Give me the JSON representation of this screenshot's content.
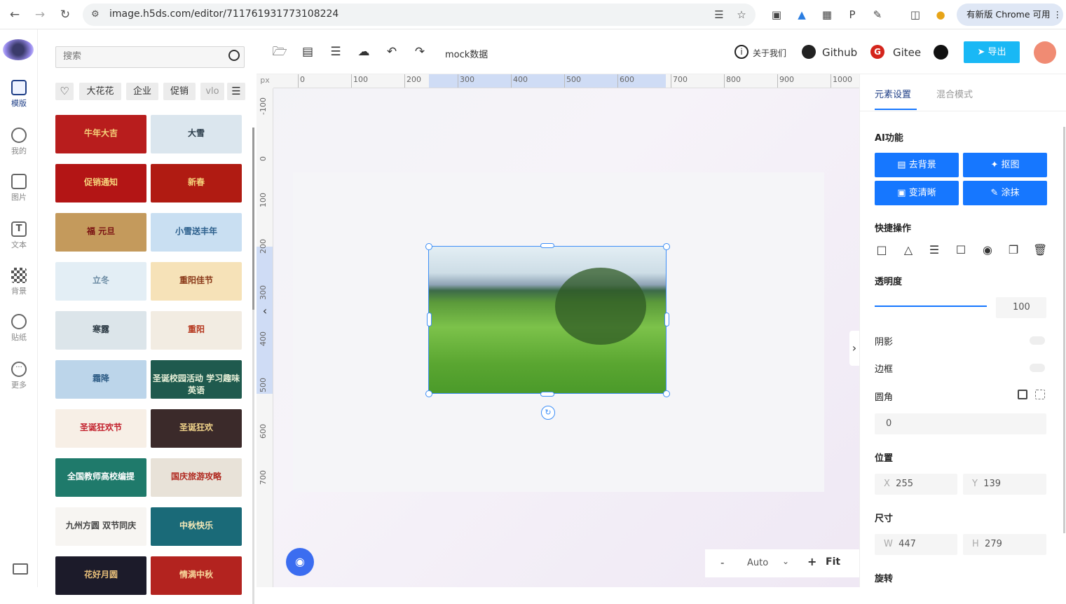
{
  "browser": {
    "url": "image.h5ds.com/editor/711761931773108224",
    "update_label": "有新版 Chrome 可用"
  },
  "rail": {
    "items": [
      {
        "label": "模版",
        "icon": "template-icon"
      },
      {
        "label": "我的",
        "icon": "cloud-upload-icon"
      },
      {
        "label": "图片",
        "icon": "image-icon"
      },
      {
        "label": "文本",
        "icon": "text-icon"
      },
      {
        "label": "背景",
        "icon": "background-icon"
      },
      {
        "label": "贴纸",
        "icon": "sticker-icon"
      },
      {
        "label": "更多",
        "icon": "more-icon"
      }
    ]
  },
  "templates": {
    "search_placeholder": "搜索",
    "tags": [
      "大花花",
      "企业",
      "促销",
      "vlo"
    ],
    "thumbs": [
      {
        "label": "牛年大吉",
        "bg": "#b81d1d",
        "fg": "#f6d37b"
      },
      {
        "label": "大雪",
        "bg": "#dbe6ee",
        "fg": "#2b3c4a"
      },
      {
        "label": "促销通知",
        "bg": "#b31515",
        "fg": "#f6d37b"
      },
      {
        "label": "新春",
        "bg": "#b01b12",
        "fg": "#f6d37b"
      },
      {
        "label": "福 元旦",
        "bg": "#c49a5c",
        "fg": "#7a1212"
      },
      {
        "label": "小雪送丰年",
        "bg": "#c9dff2",
        "fg": "#2c5f8c"
      },
      {
        "label": "立冬",
        "bg": "#e3eef5",
        "fg": "#6b8ba3"
      },
      {
        "label": "重阳佳节",
        "bg": "#f6e2b8",
        "fg": "#8a3a1a"
      },
      {
        "label": "寒露",
        "bg": "#dce5ea",
        "fg": "#2d3b45"
      },
      {
        "label": "重阳",
        "bg": "#f2ece2",
        "fg": "#b5371e"
      },
      {
        "label": "霜降",
        "bg": "#bcd5ea",
        "fg": "#2f5d86"
      },
      {
        "label": "圣诞校园活动 学习趣味英语",
        "bg": "#1f5a4e",
        "fg": "#e9f1d9"
      },
      {
        "label": "圣诞狂欢节",
        "bg": "#f7efe6",
        "fg": "#c21f2b"
      },
      {
        "label": "圣诞狂欢",
        "bg": "#3b2a2a",
        "fg": "#f0d38a"
      },
      {
        "label": "全国教师高校编提",
        "bg": "#1f7a6b",
        "fg": "#ffffff"
      },
      {
        "label": "国庆旅游攻略",
        "bg": "#e8e2d8",
        "fg": "#b0281f"
      },
      {
        "label": "九州方圆  双节同庆",
        "bg": "#f7f5f2",
        "fg": "#444444"
      },
      {
        "label": "中秋快乐",
        "bg": "#1a6a78",
        "fg": "#f5e9b8"
      },
      {
        "label": "花好月圆",
        "bg": "#1c1b2a",
        "fg": "#e9c07a"
      },
      {
        "label": "情满中秋",
        "bg": "#b3231f",
        "fg": "#f7d79b"
      }
    ]
  },
  "toolbar": {
    "mock_label": "mock数据",
    "about_label": "关于我们",
    "github_label": "Github",
    "gitee_label": "Gitee",
    "export_label": "导出"
  },
  "ruler": {
    "unit": "px",
    "top": [
      "0",
      "100",
      "200",
      "300",
      "400",
      "500",
      "600",
      "700",
      "800",
      "900",
      "1000"
    ],
    "left": [
      "-100",
      "0",
      "100",
      "200",
      "300",
      "400",
      "500",
      "600",
      "700"
    ]
  },
  "zoom": {
    "minus": "-",
    "value": "Auto",
    "plus": "+",
    "fit": "Fit"
  },
  "panel": {
    "tabs": [
      "元素设置",
      "混合模式"
    ],
    "ai_title": "AI功能",
    "ai_buttons": [
      "去背景",
      "抠图",
      "变清晰",
      "涂抹"
    ],
    "quick_title": "快捷操作",
    "opacity_title": "透明度",
    "opacity_value": "100",
    "opacity_level": 1.0,
    "shadow_label": "阴影",
    "border_label": "边框",
    "radius_label": "圆角",
    "radius_value": "0",
    "position_title": "位置",
    "x_label": "X",
    "x_value": "255",
    "y_label": "Y",
    "y_value": "139",
    "size_title": "尺寸",
    "w_label": "W",
    "w_value": "447",
    "h_label": "H",
    "h_value": "279",
    "rotate_title": "旋转"
  }
}
